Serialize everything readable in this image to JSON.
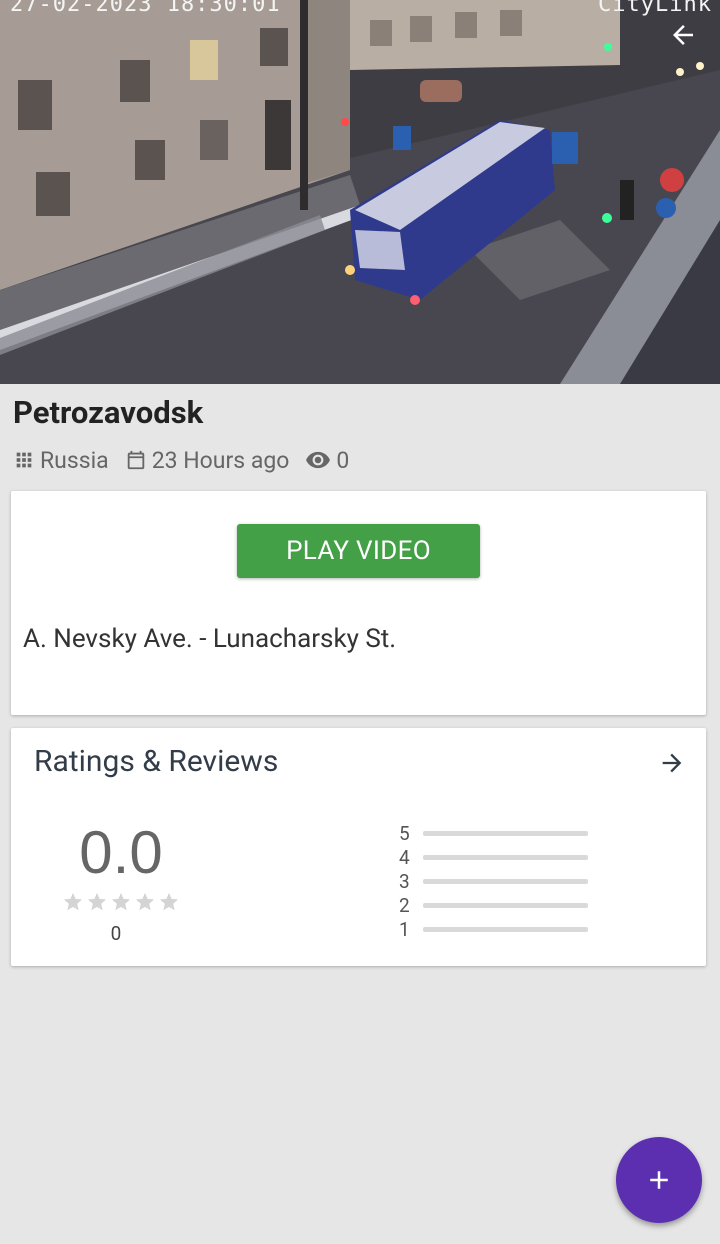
{
  "hero": {
    "timestamp": "27-02-2023 18:30:01",
    "brand": "CityLink"
  },
  "camera": {
    "title": "Petrozavodsk",
    "country": "Russia",
    "updated": "23 Hours ago",
    "views": "0"
  },
  "details": {
    "play_label": "PLAY VIDEO",
    "address": "A. Nevsky Ave. - Lunacharsky St."
  },
  "ratings": {
    "title": "Ratings & Reviews",
    "score": "0.0",
    "count": "0",
    "stars_filled": 0,
    "distribution": [
      {
        "label": "5",
        "fraction": 0
      },
      {
        "label": "4",
        "fraction": 0
      },
      {
        "label": "3",
        "fraction": 0
      },
      {
        "label": "2",
        "fraction": 0
      },
      {
        "label": "1",
        "fraction": 0
      }
    ]
  },
  "colors": {
    "play_button": "#43a047",
    "fab": "#5b2fb0",
    "background": "#e6e6e6"
  },
  "icons": {
    "back": "arrow-back-icon",
    "country": "grid-icon",
    "date": "calendar-icon",
    "views": "eye-icon",
    "ratings_link": "arrow-forward-icon",
    "fab": "plus-icon"
  }
}
